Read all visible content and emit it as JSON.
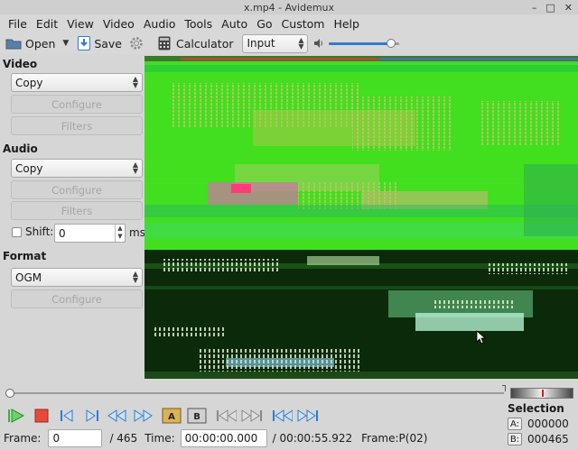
{
  "window": {
    "title": "x.mp4 - Avidemux"
  },
  "menu": [
    "File",
    "Edit",
    "View",
    "Video",
    "Audio",
    "Tools",
    "Auto",
    "Go",
    "Custom",
    "Help"
  ],
  "toolbar": {
    "open_label": "Open",
    "save_label": "Save",
    "calculator_label": "Calculator",
    "input_selected": "Input",
    "volume": 0.88
  },
  "video": {
    "title": "Video",
    "codec": "Copy",
    "configure_label": "Configure",
    "filters_label": "Filters"
  },
  "audio": {
    "title": "Audio",
    "codec": "Copy",
    "configure_label": "Configure",
    "filters_label": "Filters",
    "shift_label": "Shift:",
    "shift_value": "0",
    "shift_unit": "ms"
  },
  "format": {
    "title": "Format",
    "container": "OGM",
    "configure_label": "Configure"
  },
  "bottom": {
    "frame_label": "Frame:",
    "frame_value": "0",
    "frame_total": "/ 465",
    "time_label": "Time:",
    "time_value": "00:00:00.000",
    "time_total": "/ 00:00:55.922",
    "frame_type": "Frame:P(02)"
  },
  "selection": {
    "title": "Selection",
    "a_key": "A:",
    "a_value": "000000",
    "b_key": "B:",
    "b_value": "000465"
  },
  "colors": {
    "accent": "#2f7bd4",
    "play": "#3cb043",
    "stop": "#d9342b"
  }
}
